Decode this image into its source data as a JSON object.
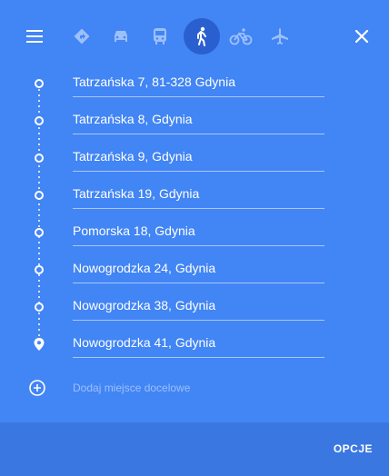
{
  "top_bar": {
    "icons": [
      "menu-icon",
      "directions-icon",
      "car-icon",
      "transit-icon",
      "walk-icon",
      "bike-icon",
      "plane-icon",
      "close-icon"
    ],
    "active_mode": "walk"
  },
  "route": {
    "stops": [
      {
        "address": "Tatrzańska 7, 81-328 Gdynia",
        "marker": "circle"
      },
      {
        "address": "Tatrzańska 8, Gdynia",
        "marker": "circle"
      },
      {
        "address": "Tatrzańska 9, Gdynia",
        "marker": "circle"
      },
      {
        "address": "Tatrzańska 19, Gdynia",
        "marker": "circle"
      },
      {
        "address": "Pomorska 18, Gdynia",
        "marker": "circle"
      },
      {
        "address": "Nowogrodzka 24, Gdynia",
        "marker": "circle"
      },
      {
        "address": "Nowogrodzka 38, Gdynia",
        "marker": "circle"
      },
      {
        "address": "Nowogrodzka 41, Gdynia",
        "marker": "pin"
      }
    ],
    "add_destination_placeholder": "Dodaj miejsce docelowe"
  },
  "footer": {
    "options_label": "OPCJE"
  },
  "colors": {
    "panel": "#4285f4",
    "footer": "#3a77e0",
    "active_mode_bg": "#2a5fcf"
  }
}
